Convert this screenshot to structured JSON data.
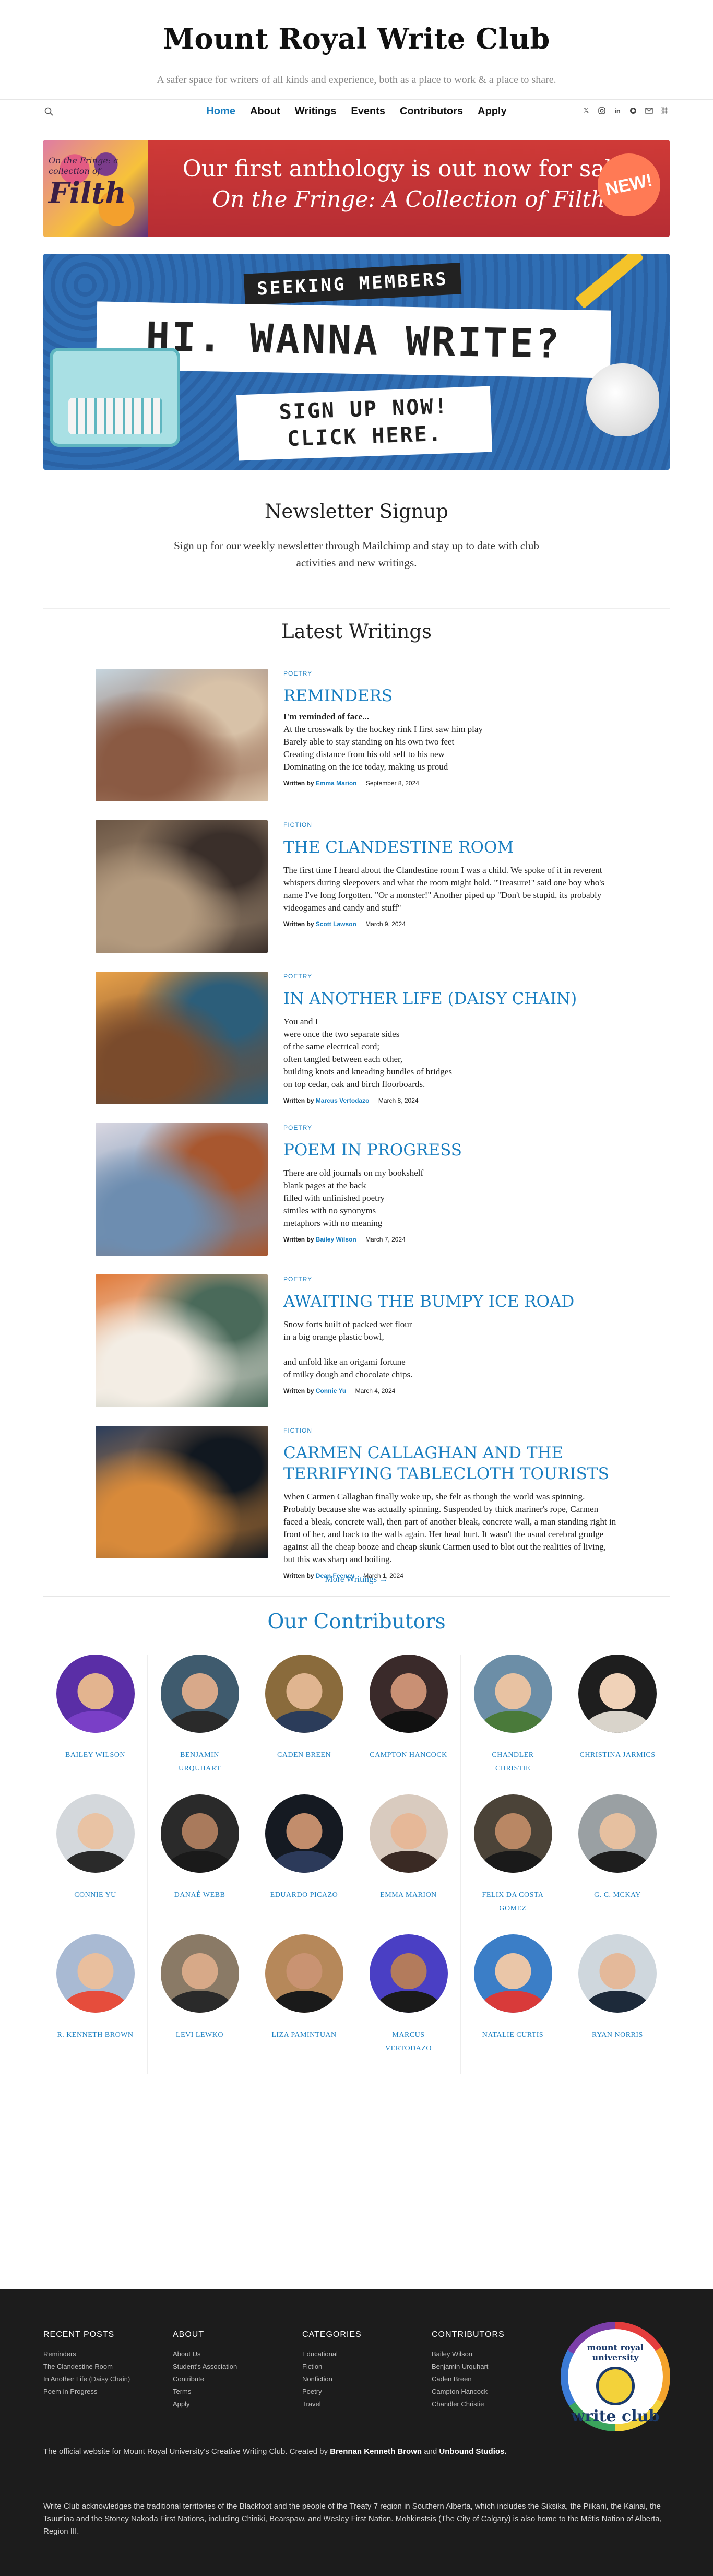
{
  "site": {
    "title": "Mount Royal Write Club",
    "tagline": "A safer space for writers of all kinds and experience, both as a place to work & a place to share."
  },
  "nav": {
    "items": [
      {
        "label": "Home",
        "active": true
      },
      {
        "label": "About"
      },
      {
        "label": "Writings"
      },
      {
        "label": "Events"
      },
      {
        "label": "Contributors"
      },
      {
        "label": "Apply"
      }
    ],
    "social_icons": [
      "x-icon",
      "instagram-icon",
      "linkedin-icon",
      "github-icon",
      "email-icon",
      "link-icon"
    ]
  },
  "banners": {
    "anthology": {
      "cover_small": "On the Fringe: a collection of",
      "cover_big": "Filth",
      "line1": "Our first anthology is out now for sale!",
      "line2": "On the Fringe: A Collection of Filth",
      "badge": "NEW!"
    },
    "seeking": {
      "tag": "SEEKING MEMBERS",
      "headline": "HI. WANNA WRITE?",
      "cta_line1": "SIGN UP NOW!",
      "cta_line2": "CLICK HERE."
    }
  },
  "newsletter": {
    "heading": "Newsletter Signup",
    "text": "Sign up for our weekly newsletter through Mailchimp and stay up to date with club activities and new writings."
  },
  "latest": {
    "heading": "Latest Writings",
    "by_label": "Written by",
    "more_label": "More Writings →",
    "posts": [
      {
        "category": "POETRY",
        "title": "REMINDERS",
        "lead": "I'm reminded of face...",
        "excerpt": "At the crosswalk by the hockey rink I first saw him play\nBarely able to stay standing on his own two feet\nCreating distance from his old self to his new\nDominating on the ice today, making us proud",
        "author": "Emma Marion",
        "date": "September 8, 2024",
        "palette": [
          "#c7d6df",
          "#8a5a43",
          "#d8c2a8"
        ]
      },
      {
        "category": "FICTION",
        "title": "THE CLANDESTINE ROOM",
        "lead": "",
        "excerpt": "The first time I heard about the Clandestine room I was a child. We spoke of it in reverent whispers during sleepovers and what the room might hold. \"Treasure!\" said one boy who's name I've long forgotten. \"Or a monster!\" Another piped up \"Don't be stupid, its probably videogames and candy and stuff\"",
        "author": "Scott Lawson",
        "date": "March 9, 2024",
        "palette": [
          "#6b5645",
          "#b39a7e",
          "#3a2f2a"
        ]
      },
      {
        "category": "POETRY",
        "title": "IN ANOTHER LIFE (DAISY CHAIN)",
        "lead": "",
        "excerpt": "You and I\nwere once the two separate sides\nof the same electrical cord;\noften tangled between each other,\nbuilding knots and kneading bundles of bridges\non top cedar, oak and birch floorboards.",
        "author": "Marcus Vertodazo",
        "date": "March 8, 2024",
        "palette": [
          "#e8a24a",
          "#7a4b2c",
          "#2c5e7a"
        ]
      },
      {
        "category": "POETRY",
        "title": "POEM IN PROGRESS",
        "lead": "",
        "excerpt": "There are old journals on my bookshelf\nblank pages at the back\nfilled with unfinished poetry\nsimiles with no synonyms\nmetaphors with no meaning",
        "author": "Bailey Wilson",
        "date": "March 7, 2024",
        "palette": [
          "#d9d7e1",
          "#6d8db0",
          "#a8572f"
        ]
      },
      {
        "category": "POETRY",
        "title": "AWAITING THE BUMPY ICE ROAD",
        "lead": "",
        "excerpt": "Snow forts built of packed wet flour\nin a big orange plastic bowl,\n\nand unfold like an origami fortune\nof milky dough and chocolate chips.",
        "author": "Connie Yu",
        "date": "March 4, 2024",
        "palette": [
          "#e07a3a",
          "#f3ede4",
          "#4a6a5a"
        ]
      },
      {
        "category": "FICTION",
        "title": "CARMEN CALLAGHAN AND THE TERRIFYING TABLECLOTH TOURISTS",
        "lead": "",
        "excerpt": "When Carmen Callaghan finally woke up, she felt as though the world was spinning. Probably because she was actually spinning. Suspended by thick mariner's rope, Carmen faced a bleak, concrete wall, then part of another bleak, concrete wall, a man standing right in front of her, and back to the walls again. Her head hurt. It wasn't the usual cerebral grudge against all the cheap booze and cheap skunk Carmen used to blot out the realities of living, but this was sharp and boiling.",
        "author": "Dean Feeney",
        "date": "March 1, 2024",
        "palette": [
          "#2a3d5c",
          "#d88a3a",
          "#111820"
        ]
      }
    ]
  },
  "contributors": {
    "heading": "Our Contributors",
    "people": [
      {
        "name": "BAILEY WILSON",
        "bg": "#5a2ea6",
        "skin": "#e3b48f",
        "shirt": "#7a3fc7"
      },
      {
        "name": "BENJAMIN URQUHART",
        "bg": "#3f5b6e",
        "skin": "#d8a98a",
        "shirt": "#2a2a2a"
      },
      {
        "name": "CADEN BREEN",
        "bg": "#8a6b3c",
        "skin": "#e0b590",
        "shirt": "#2b3c5a"
      },
      {
        "name": "CAMPTON HANCOCK",
        "bg": "#3a2a2a",
        "skin": "#c99074",
        "shirt": "#111111"
      },
      {
        "name": "CHANDLER CHRISTIE",
        "bg": "#6c8ea7",
        "skin": "#e8c2a2",
        "shirt": "#4a7a3a"
      },
      {
        "name": "CHRISTINA JARMICS",
        "bg": "#1e1e1e",
        "skin": "#f0d2b8",
        "shirt": "#d9d4cb"
      },
      {
        "name": "CONNIE YU",
        "bg": "#d4d8dc",
        "skin": "#e9c3a4",
        "shirt": "#2a2a2a"
      },
      {
        "name": "DANAÉ WEBB",
        "bg": "#2a2a2a",
        "skin": "#a97a5c",
        "shirt": "#1a1a1a"
      },
      {
        "name": "EDUARDO PICAZO",
        "bg": "#151a22",
        "skin": "#c28d6c",
        "shirt": "#2c3a5a"
      },
      {
        "name": "EMMA MARION",
        "bg": "#d9cbbf",
        "skin": "#e6b898",
        "shirt": "#3a2a24"
      },
      {
        "name": "FELIX DA COSTA GOMEZ",
        "bg": "#4b4338",
        "skin": "#b98764",
        "shirt": "#1a1a1a"
      },
      {
        "name": "G. C. MCKAY",
        "bg": "#9aa0a3",
        "skin": "#e6c0a0",
        "shirt": "#1e1e1e"
      },
      {
        "name": "R. KENNETH BROWN",
        "bg": "#a9bad3",
        "skin": "#e9bf9e",
        "shirt": "#e64d3c"
      },
      {
        "name": "LEVI LEWKO",
        "bg": "#8a7a66",
        "skin": "#d7a988",
        "shirt": "#2a2a2a"
      },
      {
        "name": "LIZA PAMINTUAN",
        "bg": "#b6885a",
        "skin": "#c99372",
        "shirt": "#1a1a1a"
      },
      {
        "name": "MARCUS VERTODAZO",
        "bg": "#4a3fc4",
        "skin": "#b37b5c",
        "shirt": "#1a1a1a"
      },
      {
        "name": "NATALIE CURTIS",
        "bg": "#3b7ec7",
        "skin": "#eac6a8",
        "shirt": "#d93a3a"
      },
      {
        "name": "RYAN NORRIS",
        "bg": "#cfd7dd",
        "skin": "#e4b99a",
        "shirt": "#1d2a3a"
      }
    ]
  },
  "footer": {
    "columns": [
      {
        "heading": "RECENT POSTS",
        "items": [
          "Reminders",
          "The Clandestine Room",
          "In Another Life (Daisy Chain)",
          "Poem in Progress"
        ]
      },
      {
        "heading": "ABOUT",
        "items": [
          "About Us",
          "Student's Association",
          "Contribute",
          "Terms",
          "Apply"
        ]
      },
      {
        "heading": "CATEGORIES",
        "items": [
          "Educational",
          "Fiction",
          "Nonfiction",
          "Poetry",
          "Travel"
        ]
      },
      {
        "heading": "CONTRIBUTORS",
        "items": [
          "Bailey Wilson",
          "Benjamin Urquhart",
          "Caden Breen",
          "Campton Hancock",
          "Chandler Christie"
        ]
      }
    ],
    "logo": {
      "univ": "mount royal university",
      "wc": "write club"
    },
    "credit_prefix": "The official website for Mount Royal University's Creative Writing Club. Created by ",
    "credit_name1": "Brennan Kenneth Brown",
    "credit_mid": " and ",
    "credit_name2": "Unbound Studios.",
    "acknowledgement": "Write Club acknowledges the traditional territories of the Blackfoot and the people of the Treaty 7 region in Southern Alberta, which includes the Siksika, the Piikani, the Kainai, the Tsuut'ina and the Stoney Nakoda First Nations, including Chiniki, Bearspaw, and Wesley First Nation. Mohkinstsis (The City of Calgary) is also home to the Métis Nation of Alberta, Region III."
  }
}
